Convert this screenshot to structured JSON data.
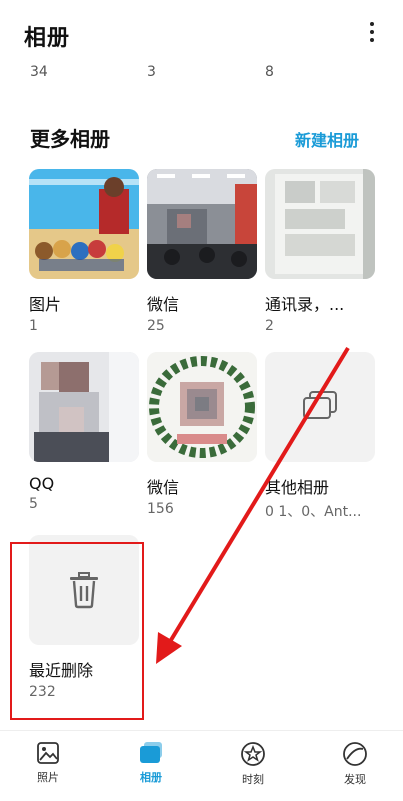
{
  "header": {
    "title": "相册",
    "menu_icon": "more-vertical-icon"
  },
  "top_counts": [
    "34",
    "3",
    "8"
  ],
  "section": {
    "title": "更多相册",
    "new_album_label": "新建相册"
  },
  "albums": [
    {
      "name": "图片",
      "count": "1"
    },
    {
      "name": "微信",
      "count": "25"
    },
    {
      "name": "通讯录，...",
      "count": "2"
    },
    {
      "name": "QQ",
      "count": "5"
    },
    {
      "name": "微信",
      "count": "156"
    },
    {
      "name": "其他相册",
      "count": "0 1、0、Ant..."
    },
    {
      "name": "最近删除",
      "count": "232"
    }
  ],
  "icons": {
    "other_albums": "albums-stack-icon",
    "recently_deleted": "trash-icon"
  },
  "tabs": [
    {
      "label": "照片",
      "icon": "photo-icon",
      "active": false
    },
    {
      "label": "相册",
      "icon": "album-icon",
      "active": true
    },
    {
      "label": "时刻",
      "icon": "star-icon",
      "active": false
    },
    {
      "label": "发现",
      "icon": "discover-icon",
      "active": false
    }
  ],
  "colors": {
    "accent": "#1a9bd7",
    "annotation": "#e21a1a"
  }
}
